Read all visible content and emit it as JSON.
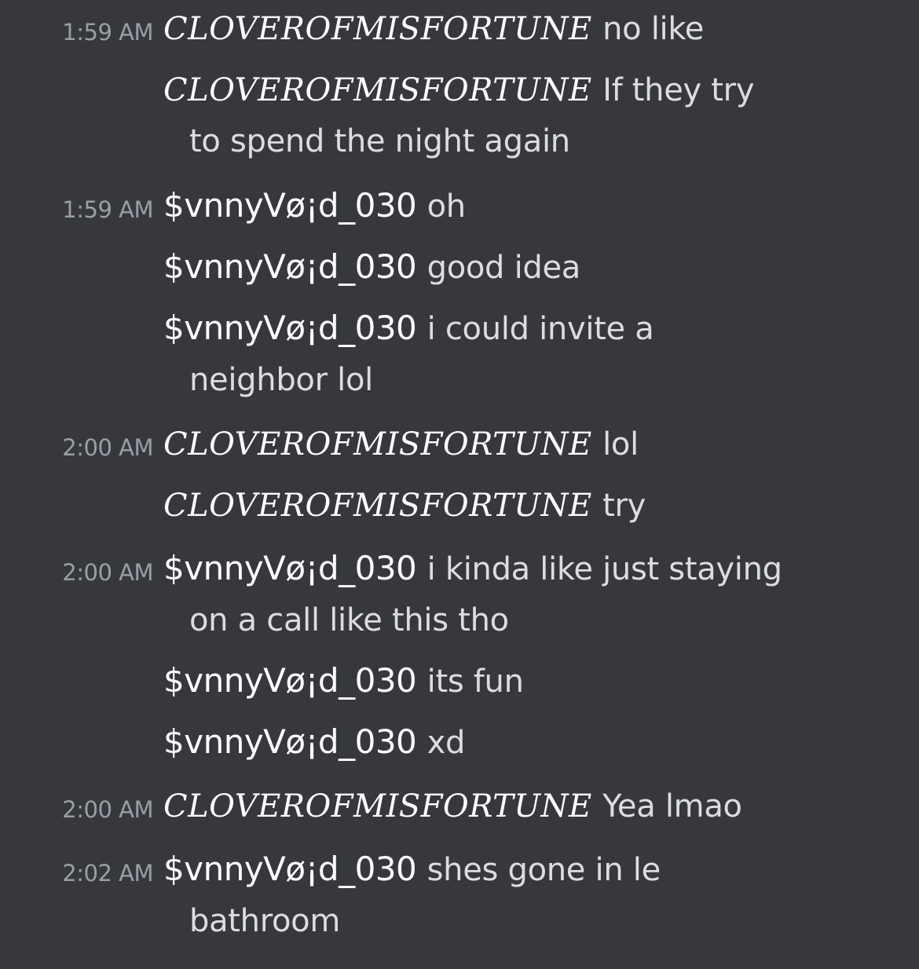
{
  "messages": [
    {
      "time": "1:59 AM",
      "user": "CLOVEROFMISFORTUNE",
      "text": "no like",
      "cont": ""
    },
    {
      "time": "",
      "user": "CLOVEROFMISFORTUNE",
      "text": "If they try",
      "cont": "to spend the night again"
    },
    {
      "time": "1:59 AM",
      "user": "$vnnyVø¡d_030",
      "text": "oh",
      "cont": ""
    },
    {
      "time": "",
      "user": "$vnnyVø¡d_030",
      "text": "good idea",
      "cont": ""
    },
    {
      "time": "",
      "user": "$vnnyVø¡d_030",
      "text": "i could invite a",
      "cont": "neighbor lol"
    },
    {
      "time": "2:00 AM",
      "user": "CLOVEROFMISFORTUNE",
      "text": "lol",
      "cont": ""
    },
    {
      "time": "",
      "user": "CLOVEROFMISFORTUNE",
      "text": "try",
      "cont": ""
    },
    {
      "time": "2:00 AM",
      "user": "$vnnyVø¡d_030",
      "text": "i kinda like just staying",
      "cont": "on a call like this tho"
    },
    {
      "time": "",
      "user": "$vnnyVø¡d_030",
      "text": "its fun",
      "cont": ""
    },
    {
      "time": "",
      "user": "$vnnyVø¡d_030",
      "text": "xd",
      "cont": ""
    },
    {
      "time": "2:00 AM",
      "user": "CLOVEROFMISFORTUNE",
      "text": "Yea lmao",
      "cont": ""
    },
    {
      "time": "2:02 AM",
      "user": "$vnnyVø¡d_030",
      "text": "shes gone in le",
      "cont": "bathroom"
    }
  ]
}
